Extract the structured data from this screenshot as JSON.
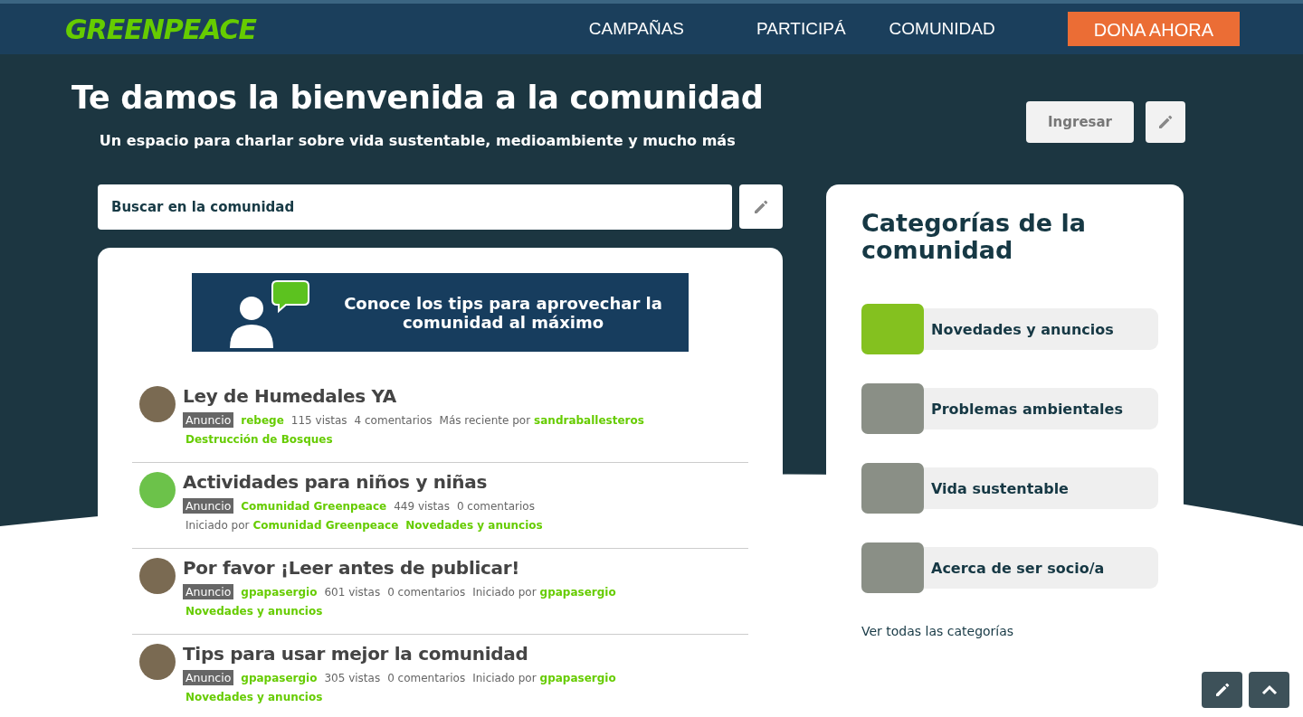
{
  "header": {
    "logo": "GREENPEACE",
    "nav": [
      "CAMPAÑAS",
      "PARTICIPÁ",
      "COMUNIDAD"
    ],
    "donate": "DONA AHORA"
  },
  "hero": {
    "title": "Te damos la bienvenida a la comunidad",
    "subtitle": "Un espacio para charlar sobre vida sustentable, medioambiente y mucho más",
    "login": "Ingresar"
  },
  "search": {
    "placeholder": "Buscar en la comunidad"
  },
  "banner": {
    "text": "Conoce los tips para aprovechar la comunidad al máximo"
  },
  "topics": [
    {
      "title": "Ley de Humedales YA",
      "kind": "photo",
      "lines": [
        [
          {
            "kind": "tag",
            "text": "Anuncio"
          },
          {
            "kind": "link",
            "text": "rebege"
          },
          {
            "kind": "text",
            "text": "115 vistas"
          },
          {
            "kind": "text",
            "text": "4 comentarios"
          },
          {
            "kind": "text",
            "text": "Más reciente por"
          },
          {
            "kind": "link",
            "text": "sandraballesteros"
          }
        ],
        [
          {
            "kind": "link",
            "text": "Destrucción de Bosques"
          }
        ]
      ]
    },
    {
      "title": "Actividades para niños y niñas",
      "kind": "logo",
      "lines": [
        [
          {
            "kind": "tag",
            "text": "Anuncio"
          },
          {
            "kind": "link",
            "text": "Comunidad Greenpeace"
          },
          {
            "kind": "text",
            "text": "449 vistas"
          },
          {
            "kind": "text",
            "text": "0 comentarios"
          }
        ],
        [
          {
            "kind": "text",
            "text": "Iniciado por"
          },
          {
            "kind": "link",
            "text": "Comunidad Greenpeace"
          },
          {
            "kind": "link",
            "text": "Novedades y anuncios"
          }
        ]
      ]
    },
    {
      "title": "Por favor ¡Leer antes de publicar!",
      "kind": "photo",
      "lines": [
        [
          {
            "kind": "tag",
            "text": "Anuncio"
          },
          {
            "kind": "link",
            "text": "gpapasergio"
          },
          {
            "kind": "text",
            "text": "601 vistas"
          },
          {
            "kind": "text",
            "text": "0 comentarios"
          },
          {
            "kind": "text",
            "text": "Iniciado por"
          },
          {
            "kind": "link",
            "text": "gpapasergio"
          }
        ],
        [
          {
            "kind": "link",
            "text": "Novedades y anuncios"
          }
        ]
      ]
    },
    {
      "title": "Tips para usar mejor la comunidad",
      "kind": "photo",
      "lines": [
        [
          {
            "kind": "tag",
            "text": "Anuncio"
          },
          {
            "kind": "link",
            "text": "gpapasergio"
          },
          {
            "kind": "text",
            "text": "305 vistas"
          },
          {
            "kind": "text",
            "text": "0 comentarios"
          },
          {
            "kind": "text",
            "text": "Iniciado por"
          },
          {
            "kind": "link",
            "text": "gpapasergio"
          }
        ],
        [
          {
            "kind": "link",
            "text": "Novedades y anuncios"
          }
        ]
      ]
    }
  ],
  "sidebar": {
    "title": "Categorías de la comunidad",
    "categories": [
      {
        "name": "Novedades y anuncios",
        "kind": "logo"
      },
      {
        "name": "Problemas ambientales",
        "kind": "photo"
      },
      {
        "name": "Vida sustentable",
        "kind": "photo"
      },
      {
        "name": "Acerca de ser socio/a",
        "kind": "photo"
      }
    ],
    "all_link": "Ver todas las categorías"
  }
}
